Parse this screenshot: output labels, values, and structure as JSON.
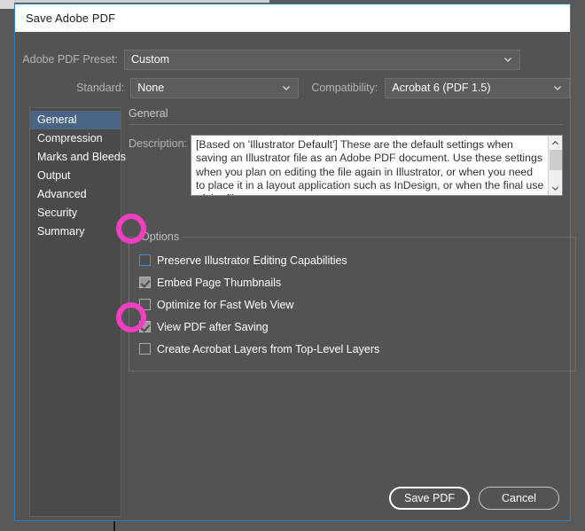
{
  "window": {
    "title": "Save Adobe PDF",
    "accent_border": "#2f7fc4",
    "background": "#535353",
    "annotation_color": "#f23fc2"
  },
  "top": {
    "preset_label": "Adobe PDF Preset:",
    "preset_value": "Custom",
    "preset_save_icon": "save-preset-icon",
    "standard_label": "Standard:",
    "standard_value": "None",
    "compatibility_label": "Compatibility:",
    "compatibility_value": "Acrobat 6 (PDF 1.5)"
  },
  "sidebar": {
    "items": [
      {
        "label": "General",
        "selected": true
      },
      {
        "label": "Compression",
        "selected": false
      },
      {
        "label": "Marks and Bleeds",
        "selected": false
      },
      {
        "label": "Output",
        "selected": false
      },
      {
        "label": "Advanced",
        "selected": false
      },
      {
        "label": "Security",
        "selected": false
      },
      {
        "label": "Summary",
        "selected": false
      }
    ]
  },
  "panel": {
    "title": "General",
    "description_label": "Description:",
    "description_value": "[Based on 'Illustrator Default'] These are the default settings when saving an Illustrator file as an Adobe PDF document. Use these settings when you plan on editing the file again in Illustrator, or when you need to place it in a layout application such as InDesign, or when the final use of the file",
    "scroll_up_icon": "chevron-up-icon",
    "scroll_down_icon": "chevron-down-icon",
    "options_legend": "Options",
    "options": [
      {
        "label": "Preserve Illustrator Editing Capabilities",
        "checked": false,
        "focused": true,
        "annotated": true
      },
      {
        "label": "Embed Page Thumbnails",
        "checked": true,
        "focused": false,
        "annotated": false
      },
      {
        "label": "Optimize for Fast Web View",
        "checked": false,
        "focused": false,
        "annotated": false
      },
      {
        "label": "View PDF after Saving",
        "checked": true,
        "focused": false,
        "annotated": false
      },
      {
        "label": "Create Acrobat Layers from Top-Level Layers",
        "checked": false,
        "focused": false,
        "annotated": true
      }
    ]
  },
  "footer": {
    "save_label": "Save PDF",
    "cancel_label": "Cancel"
  }
}
